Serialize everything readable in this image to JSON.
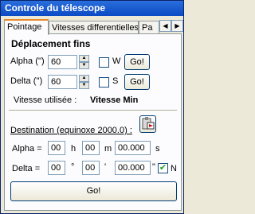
{
  "window": {
    "title": "Controle du télescope"
  },
  "tabs": [
    {
      "label": "Pointage"
    },
    {
      "label": "Vitesses differentielles"
    },
    {
      "label": "Pa"
    }
  ],
  "fine_moves": {
    "title": "Déplacement fins",
    "alpha": {
      "label": "Alpha ('')",
      "value": "60",
      "dir_label": "W",
      "go_label": "Go!"
    },
    "delta": {
      "label": "Delta ('')",
      "value": "60",
      "dir_label": "S",
      "go_label": "Go!"
    },
    "speed_label": "Vitesse utilisée :",
    "speed_value": "Vitesse Min"
  },
  "destination": {
    "label": "Destination (equinoxe 2000.0) :",
    "alpha": {
      "label": "Alpha =",
      "h": "00",
      "h_unit": "h",
      "m": "00",
      "m_unit": "m",
      "s": "00.000",
      "s_unit": "s"
    },
    "delta": {
      "label": "Delta =",
      "d": "00",
      "d_unit": "°",
      "m": "00",
      "m_unit": "'",
      "s": "00.000",
      "s_unit": "\"",
      "n_label": "N",
      "n_checked": true
    },
    "go_label": "Go!"
  },
  "icons": {
    "tab_left": "arrow-left-icon",
    "tab_right": "arrow-right-icon",
    "paste": "paste-coordinates-icon"
  }
}
